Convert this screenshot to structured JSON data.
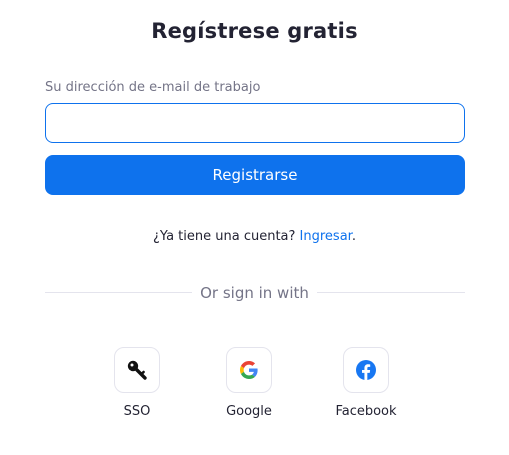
{
  "title": "Regístrese gratis",
  "email": {
    "label": "Su dirección de e-mail de trabajo",
    "value": "",
    "placeholder": ""
  },
  "register_button": "Registrarse",
  "login_prompt": {
    "text": "¿Ya tiene una cuenta? ",
    "link": "Ingresar",
    "suffix": "."
  },
  "divider_text": "Or sign in with",
  "providers": [
    {
      "label": "SSO",
      "icon": "key-icon"
    },
    {
      "label": "Google",
      "icon": "google-icon"
    },
    {
      "label": "Facebook",
      "icon": "facebook-icon"
    }
  ],
  "colors": {
    "accent": "#0e72ed",
    "text": "#232333",
    "muted": "#747487",
    "border": "#e4e4ed"
  }
}
